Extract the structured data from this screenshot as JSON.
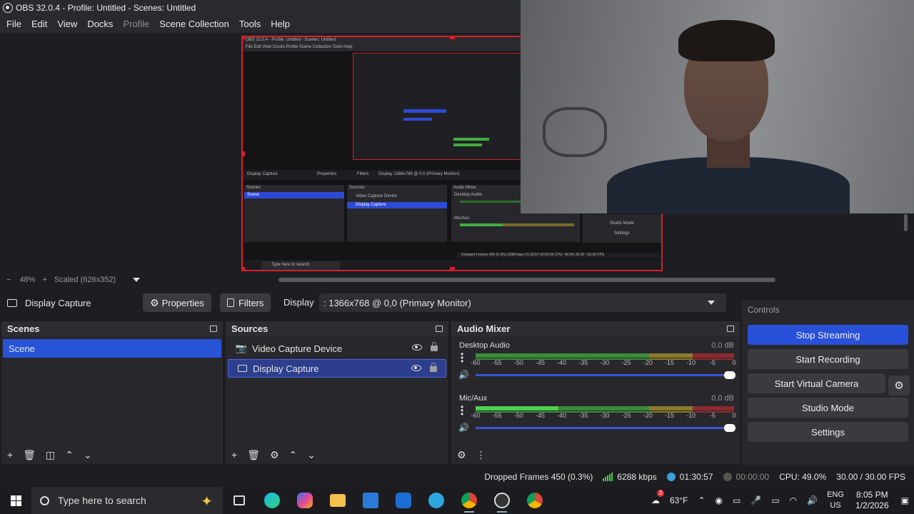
{
  "window": {
    "title": "OBS 32.0.4 - Profile: Untitled - Scenes: Untitled"
  },
  "menu": {
    "items": [
      {
        "label": "File",
        "disabled": false
      },
      {
        "label": "Edit",
        "disabled": false
      },
      {
        "label": "View",
        "disabled": false
      },
      {
        "label": "Docks",
        "disabled": false
      },
      {
        "label": "Profile",
        "disabled": true
      },
      {
        "label": "Scene Collection",
        "disabled": false
      },
      {
        "label": "Tools",
        "disabled": false
      },
      {
        "label": "Help",
        "disabled": false
      }
    ]
  },
  "preview": {
    "zoom_minus": "−",
    "zoom": "48%",
    "zoom_plus": "+",
    "scaled": "Scaled (626x352)",
    "nested": {
      "title": "OBS 32.0.4 - Profile: Untitled - Scenes: Untitled",
      "menu": "File  Edit  View  Docks  Profile  Scene Collection  Tools  Help",
      "source": "Display Capture",
      "properties": "Properties",
      "filters": "Filters",
      "display": "Display  1366x768 @ 0,0 (Primary Monitor)",
      "scenes": "Scenes",
      "scene": "Scene",
      "sources": "Sources",
      "src1": "Video Capture Device",
      "src2": "Display Capture",
      "mixer": "Audio Mixer",
      "desktop": "Desktop Audio",
      "mic": "Mic/Aux",
      "studio": "Studio Mode",
      "settings": "Settings",
      "status": "Dropped Frames 450 (0.3%)   6288 kbps   01:30:57   00:00:00  CPU: 49.0%  30.00 / 30.00 FPS",
      "search": "Type here to search"
    }
  },
  "source_toolbar": {
    "source_name": "Display Capture",
    "properties_label": "Properties",
    "filters_label": "Filters",
    "display_label": "Display",
    "display_value": ": 1366x768 @ 0,0 (Primary Monitor)"
  },
  "scenes": {
    "title": "Scenes",
    "items": [
      {
        "label": "Scene",
        "selected": true
      }
    ]
  },
  "sources": {
    "title": "Sources",
    "items": [
      {
        "label": "Video Capture Device",
        "icon": "camera-icon",
        "selected": false
      },
      {
        "label": "Display Capture",
        "icon": "monitor-icon",
        "selected": true
      }
    ]
  },
  "audio_mixer": {
    "title": "Audio Mixer",
    "ticks": [
      "-60",
      "-55",
      "-50",
      "-45",
      "-40",
      "-35",
      "-30",
      "-25",
      "-20",
      "-15",
      "-10",
      "-5",
      "0"
    ],
    "channels": [
      {
        "name": "Desktop Audio",
        "db": "0.0 dB",
        "level": 0,
        "volume": 1.0
      },
      {
        "name": "Mic/Aux",
        "db": "0.0 dB",
        "level": 0.32,
        "volume": 1.0
      }
    ]
  },
  "controls": {
    "title": "Controls",
    "stop_streaming": "Stop Streaming",
    "start_recording": "Start Recording",
    "start_virtual_camera": "Start Virtual Camera",
    "studio_mode": "Studio Mode",
    "settings": "Settings",
    "accent": "#2950d8"
  },
  "status": {
    "dropped_frames": "Dropped Frames 450 (0.3%)",
    "bitrate": "6288 kbps",
    "stream_time": "01:30:57",
    "record_time": "00:00:00",
    "cpu": "CPU: 49.0%",
    "fps": "30.00 / 30.00 FPS"
  },
  "taskbar": {
    "search_placeholder": "Type here to search",
    "weather_badge": "3",
    "weather": "63°F",
    "lang_top": "ENG",
    "lang_bottom": "US",
    "time": "8:05 PM",
    "date": "1/2/2026"
  }
}
